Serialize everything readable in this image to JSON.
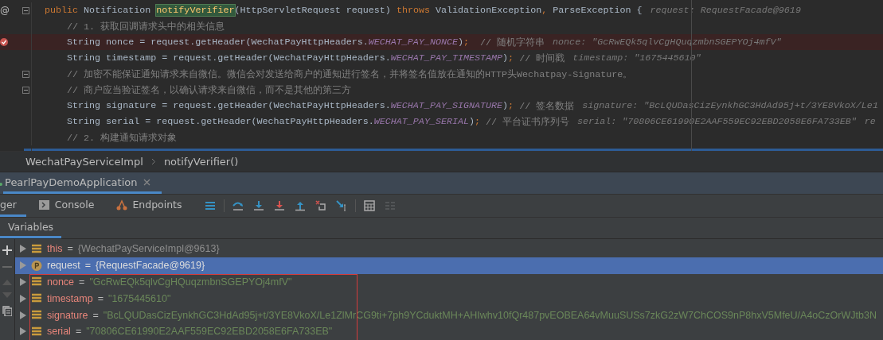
{
  "editor": {
    "lines": [
      {
        "kind": "declaration",
        "gutter_mark": "@",
        "fold": true,
        "breakpoint": false,
        "tokens": [
          {
            "kind": "kw",
            "text": "public "
          },
          {
            "kind": "plain",
            "text": "Notification "
          },
          {
            "kind": "match",
            "text": "notifyVerifier"
          },
          {
            "kind": "plain",
            "text": "(HttpServletRequest request) "
          },
          {
            "kind": "kw",
            "text": "throws "
          },
          {
            "kind": "plain",
            "text": "ValidationException"
          },
          {
            "kind": "kw",
            "text": ", "
          },
          {
            "kind": "plain",
            "text": "ParseException {"
          },
          {
            "kind": "hint",
            "text": "request: RequestFacade@9619"
          }
        ]
      },
      {
        "kind": "statement",
        "fold": false,
        "breakpoint": false,
        "tokens": [
          {
            "kind": "comment",
            "text": "// 1. 获取回调请求头中的相关信息"
          }
        ]
      },
      {
        "kind": "statement",
        "fold": false,
        "breakpoint": true,
        "tokens": [
          {
            "kind": "plain",
            "text": "String nonce = request.getHeader(WechatPayHttpHeaders."
          },
          {
            "kind": "const",
            "text": "WECHAT_PAY_NONCE"
          },
          {
            "kind": "plain",
            "text": ")"
          },
          {
            "kind": "kw",
            "text": ";  "
          },
          {
            "kind": "comment",
            "text": "// 随机字符串"
          },
          {
            "kind": "hint",
            "text": "nonce: \"GcRwEQk5qlvCgHQuqzmbnSGEPYOj4mfV\""
          }
        ]
      },
      {
        "kind": "statement",
        "fold": false,
        "breakpoint": false,
        "tokens": [
          {
            "kind": "plain",
            "text": "String timestamp = request.getHeader(WechatPayHttpHeaders."
          },
          {
            "kind": "const",
            "text": "WECHAT_PAY_TIMESTAMP"
          },
          {
            "kind": "plain",
            "text": ")"
          },
          {
            "kind": "kw",
            "text": "; "
          },
          {
            "kind": "comment",
            "text": "// 时间戳"
          },
          {
            "kind": "hint",
            "text": "timestamp: \"1675445610\""
          }
        ]
      },
      {
        "kind": "statement",
        "fold": true,
        "breakpoint": false,
        "tokens": [
          {
            "kind": "comment",
            "text": "// 加密不能保证通知请求来自微信。微信会对发送给商户的通知进行签名，并将签名值放在通知的HTTP头Wechatpay-Signature。"
          }
        ]
      },
      {
        "kind": "statement",
        "fold": true,
        "breakpoint": false,
        "tokens": [
          {
            "kind": "comment",
            "text": "// 商户应当验证签名，以确认请求来自微信，而不是其他的第三方"
          }
        ]
      },
      {
        "kind": "statement",
        "fold": false,
        "breakpoint": false,
        "tokens": [
          {
            "kind": "plain",
            "text": "String signature = request.getHeader(WechatPayHttpHeaders."
          },
          {
            "kind": "const",
            "text": "WECHAT_PAY_SIGNATURE"
          },
          {
            "kind": "plain",
            "text": ")"
          },
          {
            "kind": "kw",
            "text": "; "
          },
          {
            "kind": "comment",
            "text": "// 签名数据"
          },
          {
            "kind": "hint",
            "text": "signature: \"BcLQUDasCizEynkhGC3HdAd95j+t/3YE8VkoX/Le1"
          }
        ]
      },
      {
        "kind": "statement",
        "fold": false,
        "breakpoint": false,
        "tokens": [
          {
            "kind": "plain",
            "text": "String serial = request.getHeader(WechatPayHttpHeaders."
          },
          {
            "kind": "const",
            "text": "WECHAT_PAY_SERIAL"
          },
          {
            "kind": "plain",
            "text": ")"
          },
          {
            "kind": "kw",
            "text": "; "
          },
          {
            "kind": "comment",
            "text": "// 平台证书序列号"
          },
          {
            "kind": "hint",
            "text": "serial: \"70806CE61990E2AAF559EC92EBD2058E6FA733EB\""
          },
          {
            "kind": "hint",
            "text": "re"
          }
        ]
      },
      {
        "kind": "statement",
        "fold": false,
        "breakpoint": false,
        "tokens": [
          {
            "kind": "comment",
            "text": "// 2. 构建通知请求对象"
          }
        ]
      },
      {
        "kind": "current",
        "fold": false,
        "breakpoint": false
      }
    ]
  },
  "breadcrumbs": [
    "WechatPayServiceImpl",
    "notifyVerifier()"
  ],
  "run_tab": {
    "label": "PearlPayDemoApplication",
    "selected": true
  },
  "debug_tabs": [
    {
      "label": "ger",
      "selected": true
    },
    {
      "label": "Console",
      "selected": false
    },
    {
      "label": "Endpoints",
      "selected": false
    }
  ],
  "variables_tab": {
    "label": "Variables",
    "selected": true
  },
  "variables": [
    {
      "name": "this",
      "operator": "=",
      "value": "{WechatPayServiceImpl@9613}",
      "kind": "object",
      "selected": false,
      "outlined": false
    },
    {
      "name": "request",
      "operator": "=",
      "value": "{RequestFacade@9619}",
      "kind": "param",
      "selected": true,
      "outlined": false
    },
    {
      "name": "nonce",
      "operator": "=",
      "value": "\"GcRwEQk5qlvCgHQuqzmbnSGEPYOj4mfV\"",
      "kind": "string",
      "selected": false,
      "outlined": true
    },
    {
      "name": "timestamp",
      "operator": "=",
      "value": "\"1675445610\"",
      "kind": "string",
      "selected": false,
      "outlined": true
    },
    {
      "name": "signature",
      "operator": "=",
      "value": "\"BcLQUDasCizEynkhGC3HdAd95j+t/3YE8VkoX/Le1ZlMrCG9ti+7ph9YCduktMH+AHIwhv10fQr487pvEOBEA64vMuuSUSs7zkG2zW7ChCOS9nP8hxV5MfeU/A4oCzOrWJtb3N",
      "kind": "string",
      "selected": false,
      "outlined": true
    },
    {
      "name": "serial",
      "operator": "=",
      "value": "\"70806CE61990E2AAF559EC92EBD2058E6FA733EB\"",
      "kind": "string",
      "selected": false,
      "outlined": true
    }
  ]
}
